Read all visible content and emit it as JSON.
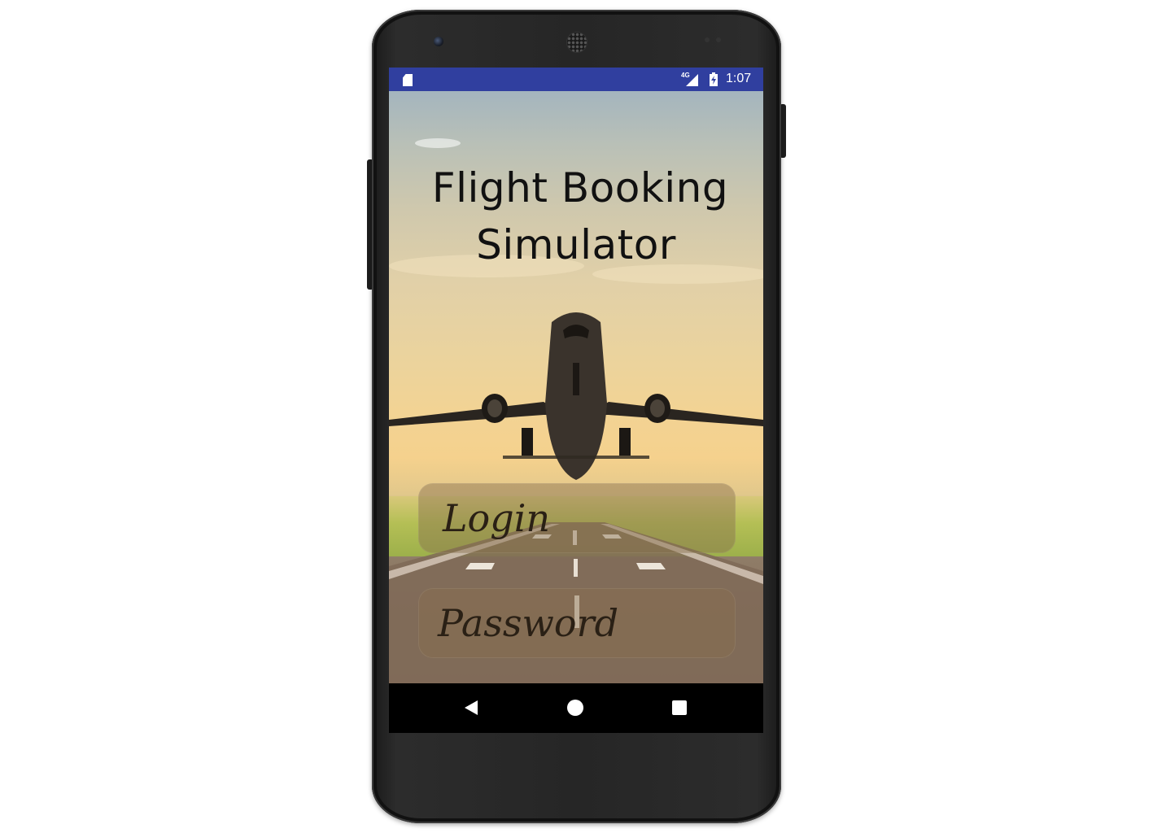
{
  "status_bar": {
    "network": "4G",
    "time": "1:07",
    "icons": [
      "sd-card-icon",
      "signal-icon",
      "battery-charging-icon"
    ],
    "color": "#303f9f"
  },
  "app": {
    "title_line1": "Flight Booking",
    "title_line2": "Simulator",
    "login_placeholder": "Login",
    "password_placeholder": "Password",
    "background": "airplane-takeoff-runway-image"
  },
  "nav_bar": {
    "icons": [
      "back-icon",
      "home-icon",
      "recents-icon"
    ]
  }
}
